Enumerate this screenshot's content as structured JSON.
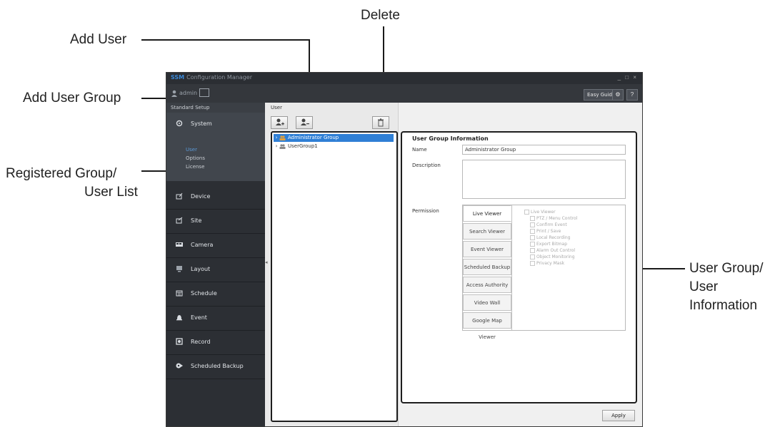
{
  "callouts": {
    "delete": "Delete",
    "add_user": "Add User",
    "add_user_group": "Add User Group",
    "registered_list_line1": "Registered Group/",
    "registered_list_line2": "User List",
    "user_info_line1": "User Group/",
    "user_info_line2": "User",
    "user_info_line3": "Information"
  },
  "titlebar": {
    "brand": "SSM",
    "title": "Configuration Manager",
    "controls": "_ □ ×"
  },
  "userbar": {
    "username": "admin",
    "easy_guide": "Easy Guide",
    "gear": "⚙",
    "help": "?"
  },
  "sidebar": {
    "header": "Standard Setup",
    "system": {
      "label": "System",
      "subitems": [
        "User",
        "Options",
        "License"
      ]
    },
    "items": [
      {
        "label": "Device"
      },
      {
        "label": "Site"
      },
      {
        "label": "Camera"
      },
      {
        "label": "Layout"
      },
      {
        "label": "Schedule"
      },
      {
        "label": "Event"
      },
      {
        "label": "Record"
      },
      {
        "label": "Scheduled Backup"
      }
    ]
  },
  "middle": {
    "header": "User",
    "tree": [
      {
        "label": "Administrator Group",
        "selected": true
      },
      {
        "label": "UserGroup1",
        "selected": false
      }
    ]
  },
  "right": {
    "section_title": "User Group Information",
    "name_label": "Name",
    "name_value": "Administrator Group",
    "description_label": "Description",
    "permission_label": "Permission",
    "tabs": [
      "Live Viewer",
      "Search Viewer",
      "Event Viewer",
      "Scheduled Backup",
      "Access Authority",
      "Video Wall",
      "Google Map Viewer"
    ],
    "active_tab": "Live Viewer",
    "permissions": [
      "Live Viewer",
      "PTZ / Menu Control",
      "Confirm Event",
      "Print / Save",
      "Local Recording",
      "Export Bitmap",
      "Alarm Out Control",
      "Object Monitoring",
      "Privacy Mask"
    ],
    "apply": "Apply"
  },
  "colors": {
    "accent": "#2f7fd5",
    "sidebar_bg": "#2c2f34",
    "titlebar_bg": "#2b2e33"
  }
}
